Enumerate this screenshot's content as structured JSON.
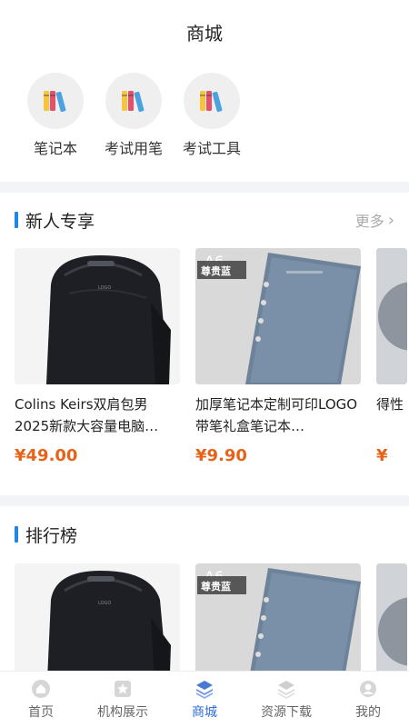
{
  "header": {
    "title": "商城"
  },
  "categories": [
    {
      "label": "笔记本",
      "icon": "books-icon"
    },
    {
      "label": "考试用笔",
      "icon": "books-icon"
    },
    {
      "label": "考试工具",
      "icon": "books-icon"
    }
  ],
  "sections": [
    {
      "title": "新人专享",
      "more": "更多",
      "products": [
        {
          "name": "Colins Keirs双肩包男2025新款大容量电脑…",
          "price": "¥49.00"
        },
        {
          "name": "加厚笔记本定制可印LOGO带笔礼盒笔记本…",
          "price": "¥9.90",
          "badge": "尊贵蓝"
        },
        {
          "name": "得性",
          "price": "¥"
        }
      ]
    },
    {
      "title": "排行榜",
      "products": [
        {
          "name": "",
          "price": ""
        },
        {
          "name": "",
          "price": "",
          "badge": "尊贵蓝"
        },
        {
          "name": "",
          "price": ""
        }
      ]
    }
  ],
  "tabbar": {
    "items": [
      {
        "label": "首页",
        "icon": "home-icon"
      },
      {
        "label": "机构展示",
        "icon": "star-badge-icon"
      },
      {
        "label": "商城",
        "icon": "layers-icon",
        "active": true
      },
      {
        "label": "资源下载",
        "icon": "stack-icon"
      },
      {
        "label": "我的",
        "icon": "user-icon"
      }
    ]
  },
  "colors": {
    "accent": "#1e88e5",
    "price": "#e8631a",
    "tab_active": "#2b6cd8"
  }
}
